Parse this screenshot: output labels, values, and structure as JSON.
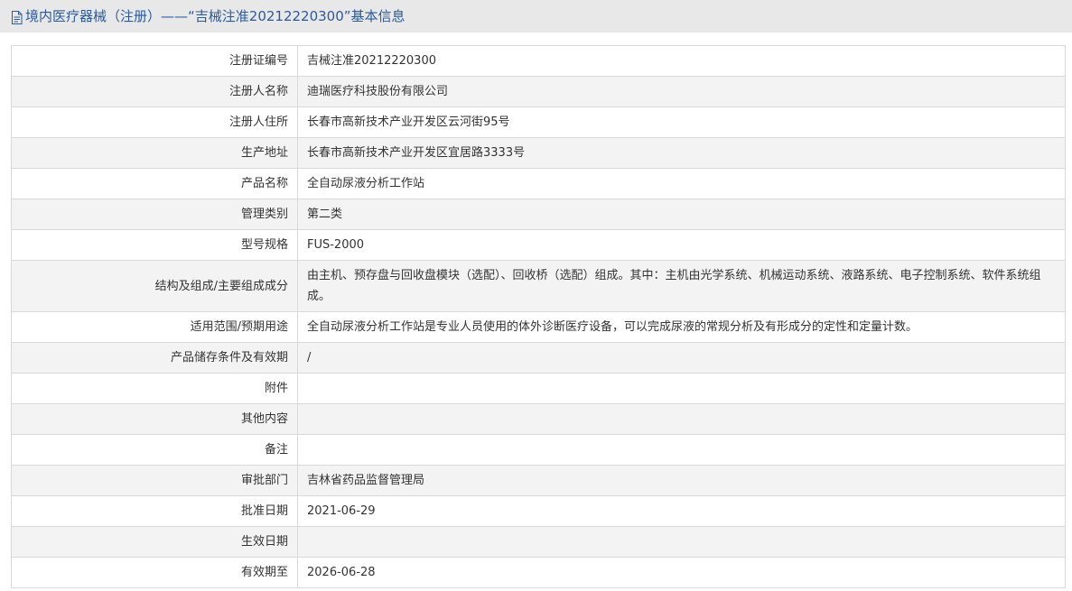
{
  "page": {
    "title": "境内医疗器械（注册）——“吉械注准20212220300”基本信息"
  },
  "rows": [
    {
      "label": "注册证编号",
      "value": "吉械注准20212220300"
    },
    {
      "label": "注册人名称",
      "value": "迪瑞医疗科技股份有限公司"
    },
    {
      "label": "注册人住所",
      "value": "长春市高新技术产业开发区云河街95号"
    },
    {
      "label": "生产地址",
      "value": "长春市高新技术产业开发区宜居路3333号"
    },
    {
      "label": "产品名称",
      "value": "全自动尿液分析工作站"
    },
    {
      "label": "管理类别",
      "value": "第二类"
    },
    {
      "label": "型号规格",
      "value": "FUS-2000"
    },
    {
      "label": "结构及组成/主要组成成分",
      "value": "由主机、预存盘与回收盘模块（选配）、回收桥（选配）组成。其中：主机由光学系统、机械运动系统、液路系统、电子控制系统、软件系统组成。"
    },
    {
      "label": "适用范围/预期用途",
      "value": "全自动尿液分析工作站是专业人员使用的体外诊断医疗设备，可以完成尿液的常规分析及有形成分的定性和定量计数。"
    },
    {
      "label": "产品储存条件及有效期",
      "value": "/"
    },
    {
      "label": "附件",
      "value": ""
    },
    {
      "label": "其他内容",
      "value": ""
    },
    {
      "label": "备注",
      "value": ""
    },
    {
      "label": "审批部门",
      "value": "吉林省药品监督管理局"
    },
    {
      "label": "批准日期",
      "value": "2021-06-29"
    },
    {
      "label": "生效日期",
      "value": ""
    },
    {
      "label": "有效期至",
      "value": "2026-06-28"
    }
  ]
}
